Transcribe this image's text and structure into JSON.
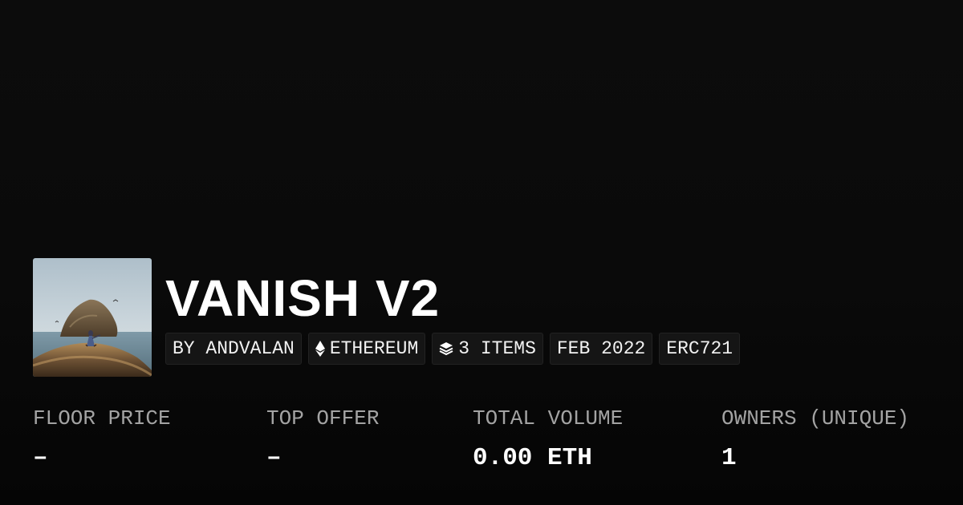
{
  "collection": {
    "name": "VANISH V2",
    "thumbnail_icon": "collection-artwork-image"
  },
  "chips": [
    {
      "label": "BY ANDVALAN",
      "icon": null
    },
    {
      "label": "ETHEREUM",
      "icon": "ethereum-icon"
    },
    {
      "label": "3 ITEMS",
      "icon": "layers-icon"
    },
    {
      "label": "FEB 2022",
      "icon": null
    },
    {
      "label": "ERC721",
      "icon": null
    }
  ],
  "stats": [
    {
      "label": "FLOOR PRICE",
      "value": "–"
    },
    {
      "label": "TOP OFFER",
      "value": "–"
    },
    {
      "label": "TOTAL VOLUME",
      "value": "0.00 ETH"
    },
    {
      "label": "OWNERS (UNIQUE)",
      "value": "1"
    }
  ],
  "colors": {
    "background": "#0a0a0a",
    "chip_background": "#151515",
    "label_gray": "#a3a3a3",
    "text": "#ffffff"
  }
}
